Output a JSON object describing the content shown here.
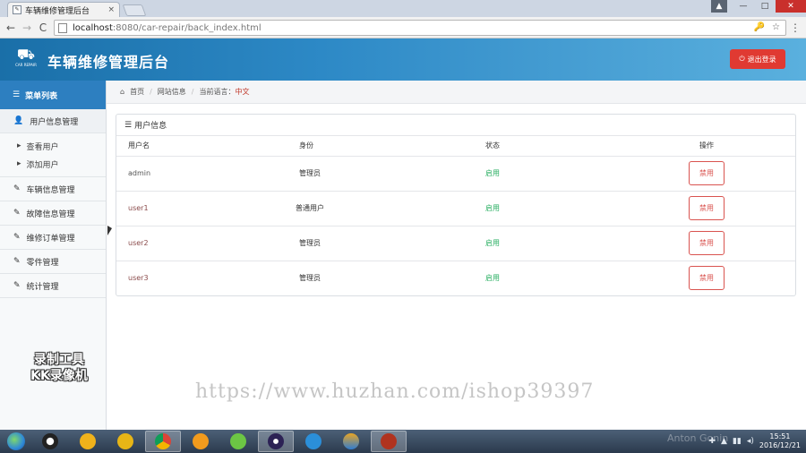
{
  "browser": {
    "tab_title": "车辆维修管理后台",
    "tab_close": "×",
    "url_host": "localhost",
    "url_path": ":8080/car-repair/back_index.html",
    "back": "←",
    "forward": "→",
    "reload": "C",
    "menu": "⋮",
    "key_icon": "🔑",
    "star_icon": "☆",
    "user_icon": "▲",
    "min_icon": "—",
    "max_icon": "□",
    "close_icon": "✕"
  },
  "header": {
    "title": "车辆维修管理后台",
    "logo_sub": "CAR REPAIR",
    "logout_label": "退出登录"
  },
  "sidebar": {
    "menu_title": "菜单列表",
    "items": [
      {
        "label": "用户信息管理",
        "icon": "user-icon",
        "sub": [
          "查看用户",
          "添加用户"
        ]
      },
      {
        "label": "车辆信息管理",
        "icon": "edit-icon"
      },
      {
        "label": "故障信息管理",
        "icon": "edit-icon"
      },
      {
        "label": "维修订单管理",
        "icon": "edit-icon"
      },
      {
        "label": "零件管理",
        "icon": "edit-icon"
      },
      {
        "label": "统计管理",
        "icon": "edit-icon"
      }
    ],
    "watermark_line1": "录制工具",
    "watermark_line2": "KK录像机"
  },
  "breadcrumb": {
    "home": "首页",
    "site_info": "网站信息",
    "lang_label": "当前语言：",
    "lang_value": "中文"
  },
  "panel": {
    "title": "用户信息",
    "columns": [
      "用户名",
      "身份",
      "状态",
      "操作"
    ],
    "rows": [
      {
        "username": "admin",
        "role": "管理员",
        "status": "启用",
        "action": "禁用"
      },
      {
        "username": "user1",
        "role": "普通用户",
        "status": "启用",
        "action": "禁用"
      },
      {
        "username": "user2",
        "role": "管理员",
        "status": "启用",
        "action": "禁用"
      },
      {
        "username": "user3",
        "role": "管理员",
        "status": "启用",
        "action": "禁用"
      }
    ]
  },
  "overlay": {
    "watermark_url": "https://www.huzhan.com/ishop39397",
    "anton": "Anton Gonin"
  },
  "taskbar": {
    "time": "15:51",
    "date": "2016/12/21"
  },
  "colors": {
    "header_gradient_start": "#1a6fa8",
    "sidebar_head": "#2d7fc0",
    "logout": "#e03a32",
    "status_green": "#27ae60",
    "ban_red": "#d9534f"
  }
}
